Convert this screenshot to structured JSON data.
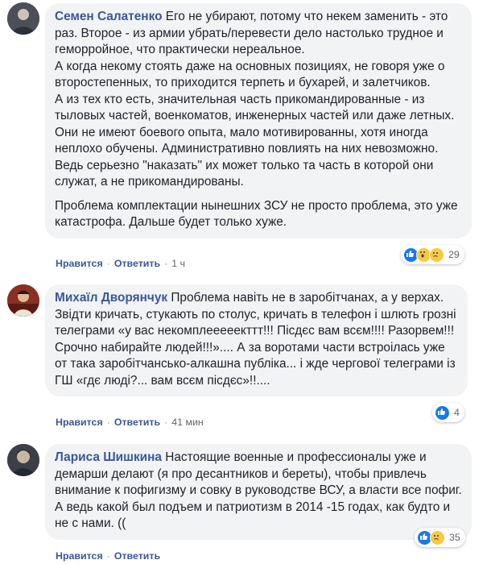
{
  "comments": [
    {
      "author": "Семен Салатенко",
      "paragraphs": [
        "Его не убирают, потому что некем заменить - это раз. Второе - из армии убрать/перевести дело настолько трудное и геморройное, что практически нереальное.",
        "А когда некому стоять даже на основных позициях, не говоря уже о второстепенных, то приходится терпеть и бухарей, и залетчиков.",
        "А из тех кто есть, значительная часть прикомандированные - из тыловых частей, военкоматов, инженерных частей или даже летных. Они не имеют боевого опыта, мало мотивированны, хотя иногда неплохо обучены. Административно повлиять на них невозможно. Ведь серьезно \"наказать\" их может только та часть в которой они служат, а не прикомандированы.",
        "Проблема комплектации нынешних ЗСУ не просто проблема, это уже катастрофа. Дальше будет только хуже."
      ],
      "like_label": "Нравится",
      "reply_label": "Ответить",
      "time": "1 ч",
      "reaction_icons": [
        "like-icon",
        "wow-icon",
        "sad-icon"
      ],
      "reaction_count": "29"
    },
    {
      "author": "Михаїл Дворянчук",
      "paragraphs": [
        "Проблема навіть не в заробітчанах, а у верхах. Звідти кричать, стукають по столус, кричать в телефон і шлють грозні телеграми «у вас некомплееееекттт!!! Пісдєс вам всєм!!!! Разорвем!!! Срочно набирайте людей!!!».... А за воротами части встроілась уже от така заробітчансько-алкашна публіка... і жде чергової телеграми із ГШ «гдє люді?... вам всєм пісдєс»!!...."
      ],
      "like_label": "Нравится",
      "reply_label": "Ответить",
      "time": "41 мин",
      "reaction_icons": [
        "like-icon"
      ],
      "reaction_count": "4"
    },
    {
      "author": "Лариса Шишкина",
      "paragraphs": [
        "Настоящие военные и профессионалы уже и демарши делают (я про десантников и береты), чтобы привлечь внимание к пофигизму и совку в руководстве ВСУ, а власти все пофиг. А ведь какой был подъем и патриотизм в 2014 -15 годах, как будто и не с нами. (("
      ],
      "like_label": "Нравится",
      "reply_label": "Ответить",
      "time": "",
      "reaction_icons": [
        "like-icon",
        "sad-icon"
      ],
      "reaction_count": "35"
    }
  ],
  "colors": {
    "author": "#385898",
    "bubble": "#f2f3f5",
    "meta": "#606770",
    "like": "#1877f2",
    "emoji": "#f7c945"
  }
}
